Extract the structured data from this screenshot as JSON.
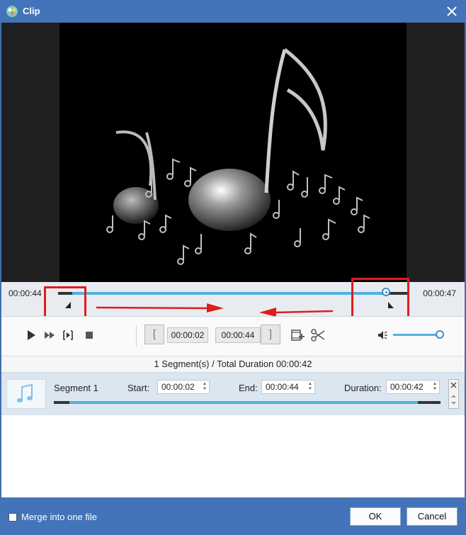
{
  "window": {
    "title": "Clip",
    "close_icon": "close-icon"
  },
  "timeline": {
    "start_time": "00:00:44",
    "end_time": "00:00:47",
    "playhead_fraction": 0.9
  },
  "controls": {
    "trim_start": "00:00:02",
    "trim_end": "00:00:44",
    "volume_fraction": 0.9
  },
  "segments": {
    "summary": "1 Segment(s) / Total Duration 00:00:42",
    "items": [
      {
        "name": "Segment 1",
        "start_label": "Start:",
        "start": "00:00:02",
        "end_label": "End:",
        "end": "00:00:44",
        "duration_label": "Duration:",
        "duration": "00:00:42"
      }
    ]
  },
  "footer": {
    "merge_label": "Merge into one file",
    "merge_checked": false,
    "ok_label": "OK",
    "cancel_label": "Cancel"
  },
  "colors": {
    "title_bar": "#4373b8",
    "accent": "#4fb1e2",
    "annotation_red": "#e01d1d"
  }
}
